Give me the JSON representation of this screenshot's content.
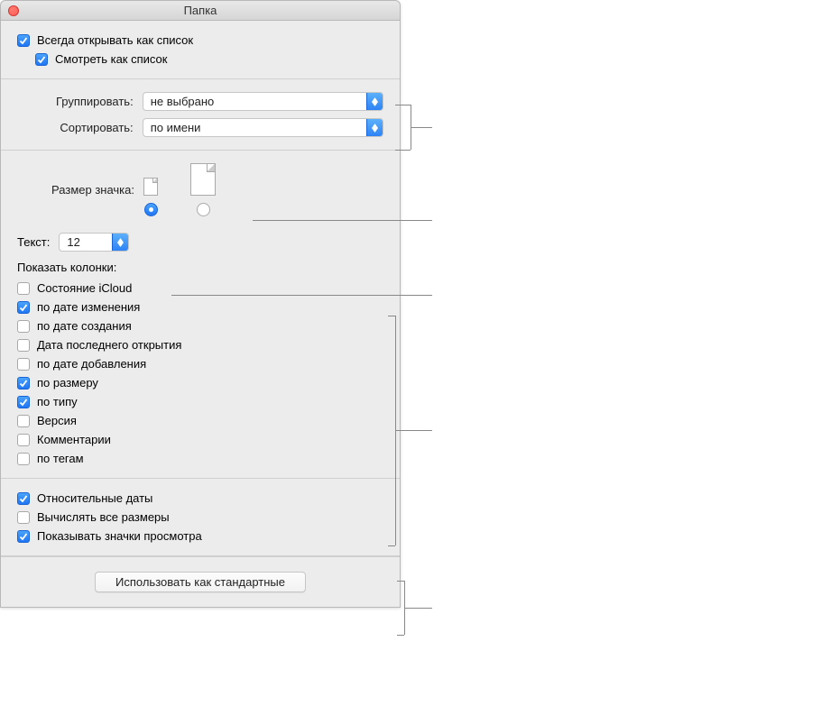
{
  "window_title": "Папка",
  "top": {
    "always_open_as_list": {
      "label": "Всегда открывать как список",
      "checked": true
    },
    "view_as_list": {
      "label": "Смотреть как список",
      "checked": true
    }
  },
  "group": {
    "label": "Группировать:",
    "value": "не выбрано"
  },
  "sort": {
    "label": "Сортировать:",
    "value": "по имени"
  },
  "icon_size_label": "Размер значка:",
  "text_label": "Текст:",
  "text_value": "12",
  "columns_label": "Показать колонки:",
  "columns": [
    {
      "label": "Состояние iCloud",
      "checked": false,
      "name": "column-icloud-status"
    },
    {
      "label": "по дате изменения",
      "checked": true,
      "name": "column-date-modified"
    },
    {
      "label": "по дате создания",
      "checked": false,
      "name": "column-date-created"
    },
    {
      "label": "Дата последнего открытия",
      "checked": false,
      "name": "column-date-last-opened"
    },
    {
      "label": "по дате добавления",
      "checked": false,
      "name": "column-date-added"
    },
    {
      "label": "по размеру",
      "checked": true,
      "name": "column-size"
    },
    {
      "label": "по типу",
      "checked": true,
      "name": "column-kind"
    },
    {
      "label": "Версия",
      "checked": false,
      "name": "column-version"
    },
    {
      "label": "Комментарии",
      "checked": false,
      "name": "column-comments"
    },
    {
      "label": "по тегам",
      "checked": false,
      "name": "column-tags"
    }
  ],
  "options": [
    {
      "label": "Относительные даты",
      "checked": true,
      "name": "opt-relative-dates"
    },
    {
      "label": "Вычислять все размеры",
      "checked": false,
      "name": "opt-calculate-all-sizes"
    },
    {
      "label": "Показывать значки просмотра",
      "checked": true,
      "name": "opt-show-preview-icons"
    }
  ],
  "footer_button": "Использовать как стандартные"
}
